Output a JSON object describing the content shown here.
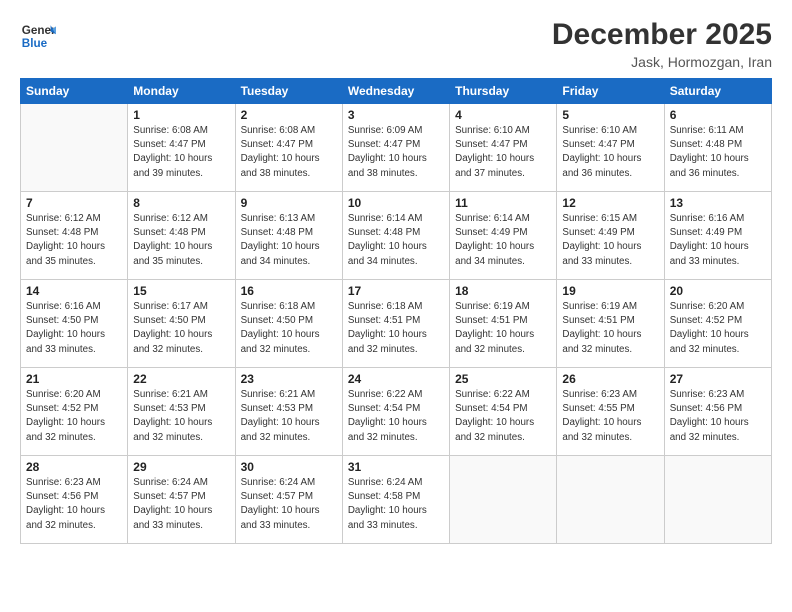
{
  "logo": {
    "line1": "General",
    "line2": "Blue"
  },
  "title": "December 2025",
  "location": "Jask, Hormozgan, Iran",
  "days_of_week": [
    "Sunday",
    "Monday",
    "Tuesday",
    "Wednesday",
    "Thursday",
    "Friday",
    "Saturday"
  ],
  "weeks": [
    [
      {
        "day": "",
        "sunrise": "",
        "sunset": "",
        "daylight": ""
      },
      {
        "day": "1",
        "sunrise": "6:08 AM",
        "sunset": "4:47 PM",
        "daylight": "10 hours and 39 minutes."
      },
      {
        "day": "2",
        "sunrise": "6:08 AM",
        "sunset": "4:47 PM",
        "daylight": "10 hours and 38 minutes."
      },
      {
        "day": "3",
        "sunrise": "6:09 AM",
        "sunset": "4:47 PM",
        "daylight": "10 hours and 38 minutes."
      },
      {
        "day": "4",
        "sunrise": "6:10 AM",
        "sunset": "4:47 PM",
        "daylight": "10 hours and 37 minutes."
      },
      {
        "day": "5",
        "sunrise": "6:10 AM",
        "sunset": "4:47 PM",
        "daylight": "10 hours and 36 minutes."
      },
      {
        "day": "6",
        "sunrise": "6:11 AM",
        "sunset": "4:48 PM",
        "daylight": "10 hours and 36 minutes."
      }
    ],
    [
      {
        "day": "7",
        "sunrise": "6:12 AM",
        "sunset": "4:48 PM",
        "daylight": "10 hours and 35 minutes."
      },
      {
        "day": "8",
        "sunrise": "6:12 AM",
        "sunset": "4:48 PM",
        "daylight": "10 hours and 35 minutes."
      },
      {
        "day": "9",
        "sunrise": "6:13 AM",
        "sunset": "4:48 PM",
        "daylight": "10 hours and 34 minutes."
      },
      {
        "day": "10",
        "sunrise": "6:14 AM",
        "sunset": "4:48 PM",
        "daylight": "10 hours and 34 minutes."
      },
      {
        "day": "11",
        "sunrise": "6:14 AM",
        "sunset": "4:49 PM",
        "daylight": "10 hours and 34 minutes."
      },
      {
        "day": "12",
        "sunrise": "6:15 AM",
        "sunset": "4:49 PM",
        "daylight": "10 hours and 33 minutes."
      },
      {
        "day": "13",
        "sunrise": "6:16 AM",
        "sunset": "4:49 PM",
        "daylight": "10 hours and 33 minutes."
      }
    ],
    [
      {
        "day": "14",
        "sunrise": "6:16 AM",
        "sunset": "4:50 PM",
        "daylight": "10 hours and 33 minutes."
      },
      {
        "day": "15",
        "sunrise": "6:17 AM",
        "sunset": "4:50 PM",
        "daylight": "10 hours and 32 minutes."
      },
      {
        "day": "16",
        "sunrise": "6:18 AM",
        "sunset": "4:50 PM",
        "daylight": "10 hours and 32 minutes."
      },
      {
        "day": "17",
        "sunrise": "6:18 AM",
        "sunset": "4:51 PM",
        "daylight": "10 hours and 32 minutes."
      },
      {
        "day": "18",
        "sunrise": "6:19 AM",
        "sunset": "4:51 PM",
        "daylight": "10 hours and 32 minutes."
      },
      {
        "day": "19",
        "sunrise": "6:19 AM",
        "sunset": "4:51 PM",
        "daylight": "10 hours and 32 minutes."
      },
      {
        "day": "20",
        "sunrise": "6:20 AM",
        "sunset": "4:52 PM",
        "daylight": "10 hours and 32 minutes."
      }
    ],
    [
      {
        "day": "21",
        "sunrise": "6:20 AM",
        "sunset": "4:52 PM",
        "daylight": "10 hours and 32 minutes."
      },
      {
        "day": "22",
        "sunrise": "6:21 AM",
        "sunset": "4:53 PM",
        "daylight": "10 hours and 32 minutes."
      },
      {
        "day": "23",
        "sunrise": "6:21 AM",
        "sunset": "4:53 PM",
        "daylight": "10 hours and 32 minutes."
      },
      {
        "day": "24",
        "sunrise": "6:22 AM",
        "sunset": "4:54 PM",
        "daylight": "10 hours and 32 minutes."
      },
      {
        "day": "25",
        "sunrise": "6:22 AM",
        "sunset": "4:54 PM",
        "daylight": "10 hours and 32 minutes."
      },
      {
        "day": "26",
        "sunrise": "6:23 AM",
        "sunset": "4:55 PM",
        "daylight": "10 hours and 32 minutes."
      },
      {
        "day": "27",
        "sunrise": "6:23 AM",
        "sunset": "4:56 PM",
        "daylight": "10 hours and 32 minutes."
      }
    ],
    [
      {
        "day": "28",
        "sunrise": "6:23 AM",
        "sunset": "4:56 PM",
        "daylight": "10 hours and 32 minutes."
      },
      {
        "day": "29",
        "sunrise": "6:24 AM",
        "sunset": "4:57 PM",
        "daylight": "10 hours and 33 minutes."
      },
      {
        "day": "30",
        "sunrise": "6:24 AM",
        "sunset": "4:57 PM",
        "daylight": "10 hours and 33 minutes."
      },
      {
        "day": "31",
        "sunrise": "6:24 AM",
        "sunset": "4:58 PM",
        "daylight": "10 hours and 33 minutes."
      },
      {
        "day": "",
        "sunrise": "",
        "sunset": "",
        "daylight": ""
      },
      {
        "day": "",
        "sunrise": "",
        "sunset": "",
        "daylight": ""
      },
      {
        "day": "",
        "sunrise": "",
        "sunset": "",
        "daylight": ""
      }
    ]
  ]
}
